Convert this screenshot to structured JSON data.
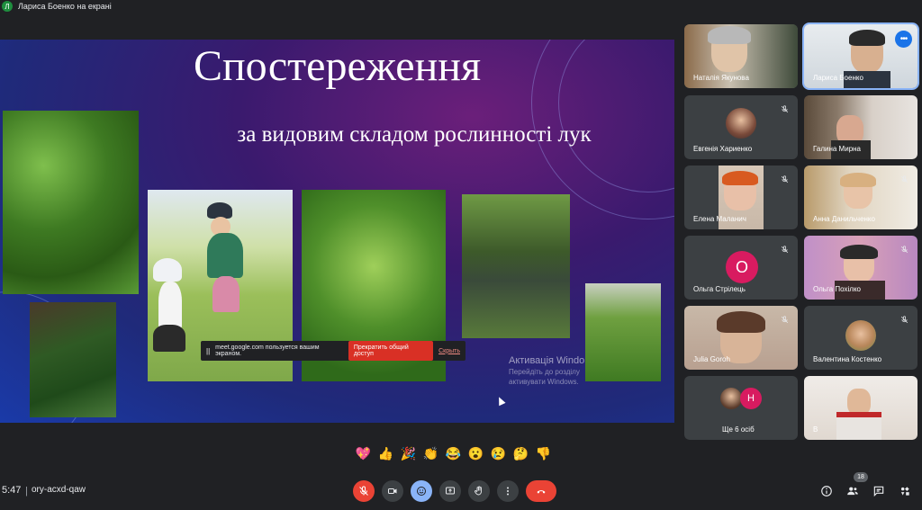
{
  "topbar": {
    "avatar_letter": "Л",
    "presenter_label": "Лариса Боенко на екрані"
  },
  "slide": {
    "title": "Спостереження",
    "subtitle": "за видовим складом рослинності лук",
    "watermark_line1": "Активація Windo",
    "watermark_line2": "Перейдіть до розділу",
    "watermark_line3": "активувати Windows."
  },
  "share_bar": {
    "pause_icon": "||",
    "message": "meet.google.com пользуется вашим экраном.",
    "stop_label": "Прекратить общий доступ",
    "hide_label": "Скрыть"
  },
  "participants": [
    {
      "name": "Наталія Якунова"
    },
    {
      "name": "Лариса Боенко"
    },
    {
      "name": "Евгенія Хариенко"
    },
    {
      "name": "Галина Мирна"
    },
    {
      "name": "Елена Маланич"
    },
    {
      "name": "Анна Данильченко"
    },
    {
      "name": "Ольга Стрілець",
      "letter": "О"
    },
    {
      "name": "Ольга Похілко"
    },
    {
      "name": "Julia Goroh"
    },
    {
      "name": "Валентина Костенко"
    },
    {
      "name": "Ще 6 осіб",
      "letter": "Н"
    },
    {
      "name": "В"
    }
  ],
  "reactions": [
    "💖",
    "👍",
    "🎉",
    "👏",
    "😂",
    "😮",
    "😢",
    "🤔",
    "👎"
  ],
  "bottom": {
    "time": "5:47",
    "separator": "|",
    "meeting_code": "ory-acxd-qaw",
    "participant_count": "18"
  },
  "colors": {
    "end_call": "#ea4335",
    "active_tile": "#8ab4f8",
    "letter_avatar": "#d81b60"
  }
}
